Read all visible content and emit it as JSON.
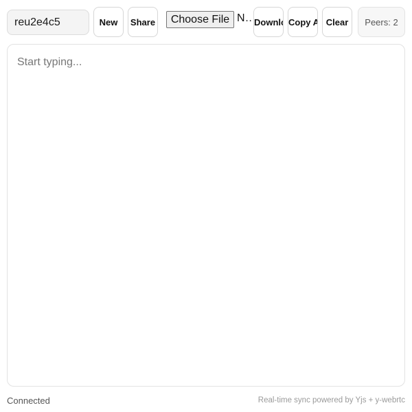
{
  "toolbar": {
    "room_id": "reu2e4c5",
    "new_label": "New",
    "share_label": "Share",
    "file_button_label": "Choose File",
    "file_status": "No file chosen",
    "download_label": "Download",
    "copy_all_label": "Copy All",
    "clear_label": "Clear",
    "peers_label": "Peers: 2"
  },
  "editor": {
    "placeholder": "Start typing...",
    "value": ""
  },
  "footer": {
    "status": "Connected",
    "powered_by": "Real-time sync powered by Yjs + y-webrtc"
  }
}
